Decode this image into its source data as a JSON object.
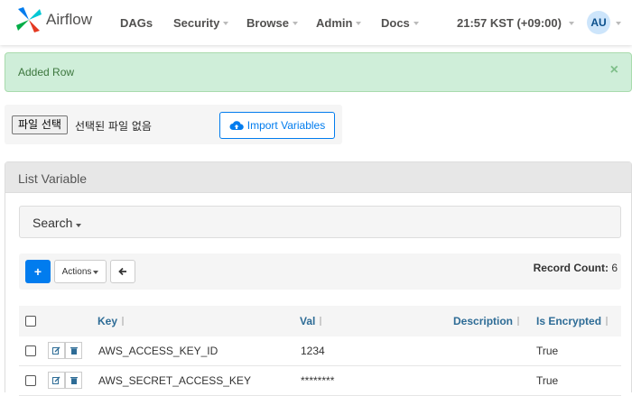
{
  "navbar": {
    "brand": "Airflow",
    "items": [
      {
        "label": "DAGs"
      },
      {
        "label": "Security"
      },
      {
        "label": "Browse"
      },
      {
        "label": "Admin"
      },
      {
        "label": "Docs"
      }
    ],
    "time": "21:57 KST (+09:00)",
    "avatar": "AU"
  },
  "alert": {
    "text": "Added Row",
    "close": "×"
  },
  "import": {
    "file_button": "파일 선택",
    "file_none": "선택된 파일 없음",
    "import_button": "Import Variables"
  },
  "panel": {
    "title": "List Variable",
    "search_label": "Search",
    "actions_label": "Actions",
    "add_label": "+",
    "record_count_label": "Record Count:",
    "record_count": "6"
  },
  "table": {
    "columns": [
      "Key",
      "Val",
      "Description",
      "Is Encrypted"
    ],
    "rows": [
      {
        "key": "AWS_ACCESS_KEY_ID",
        "val": "1234",
        "description": "",
        "encrypted": "True"
      },
      {
        "key": "AWS_SECRET_ACCESS_KEY",
        "val": "********",
        "description": "",
        "encrypted": "True"
      }
    ]
  },
  "colors": {
    "accent": "#017cee",
    "alert_bg": "#cfeed9",
    "alert_text": "#3c763d",
    "header_link": "#2e6c96"
  }
}
